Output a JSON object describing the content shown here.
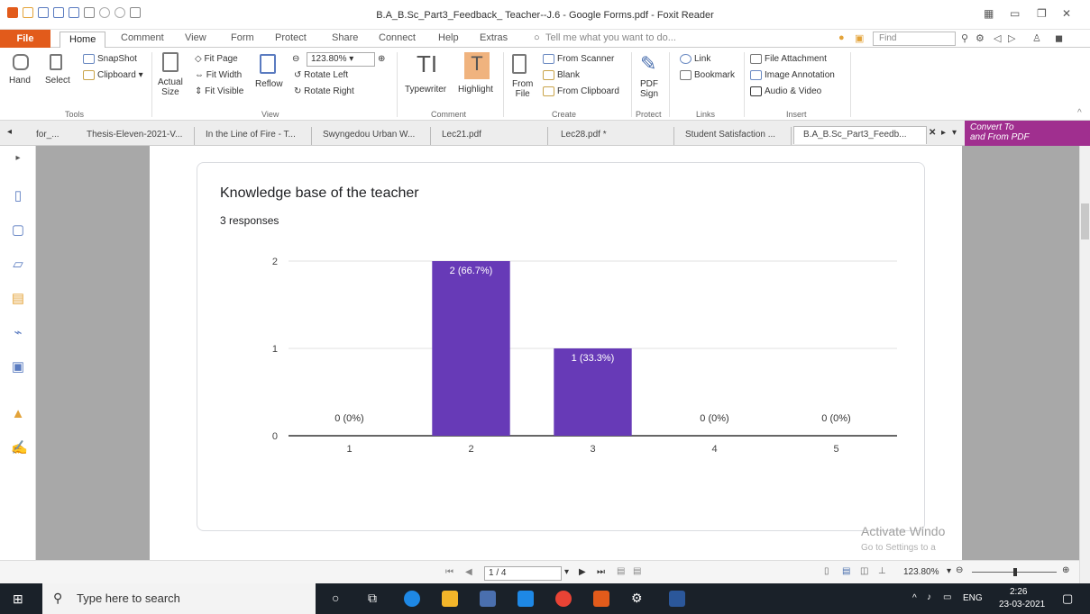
{
  "window": {
    "title": "B.A_B.Sc_Part3_Feedback_ Teacher--J.6 - Google Forms.pdf - Foxit Reader"
  },
  "menu": {
    "tabs": [
      "File",
      "Home",
      "Comment",
      "View",
      "Form",
      "Protect",
      "Share",
      "Connect",
      "Help",
      "Extras"
    ],
    "tell_me": "Tell me what you want to do...",
    "find_placeholder": "Find"
  },
  "ribbon": {
    "tools": {
      "hand": "Hand",
      "select": "Select",
      "snapshot": "SnapShot",
      "clipboard": "Clipboard",
      "group": "Tools"
    },
    "view": {
      "actual_size_1": "Actual",
      "actual_size_2": "Size",
      "fit_page": "Fit Page",
      "fit_width": "Fit Width",
      "fit_visible": "Fit Visible",
      "reflow": "Reflow",
      "zoom": "123.80%",
      "rotate_left": "Rotate Left",
      "rotate_right": "Rotate Right",
      "group": "View"
    },
    "comment": {
      "typewriter": "Typewriter",
      "highlight": "Highlight",
      "group": "Comment"
    },
    "create": {
      "from_file_1": "From",
      "from_file_2": "File",
      "from_scanner": "From Scanner",
      "blank": "Blank",
      "from_clipboard": "From Clipboard",
      "group": "Create"
    },
    "protect": {
      "pdf_sign_1": "PDF",
      "pdf_sign_2": "Sign",
      "group": "Protect"
    },
    "links": {
      "link": "Link",
      "bookmark": "Bookmark",
      "group": "Links"
    },
    "insert": {
      "file_attachment": "File Attachment",
      "image_annotation": "Image Annotation",
      "audio_video": "Audio & Video",
      "group": "Insert"
    }
  },
  "doc_tabs": [
    "for_...",
    "Thesis-Eleven-2021-V...",
    "In the Line of Fire - T...",
    "Swyngedou Urban W...",
    "Lec21.pdf",
    "Lec28.pdf *",
    "Student Satisfaction ...",
    "B.A_B.Sc_Part3_Feedb..."
  ],
  "convert": {
    "line1": "Convert To",
    "line2": "and From PDF"
  },
  "form": {
    "question": "Knowledge base of the teacher",
    "responses": "3 responses"
  },
  "chart_data": {
    "type": "bar",
    "categories": [
      "1",
      "2",
      "3",
      "4",
      "5"
    ],
    "values": [
      0,
      2,
      1,
      0,
      0
    ],
    "data_labels": [
      "0 (0%)",
      "2 (66.7%)",
      "1 (33.3%)",
      "0 (0%)",
      "0 (0%)"
    ],
    "yticks": [
      "0",
      "1",
      "2"
    ],
    "ylim": [
      0,
      2
    ],
    "bar_color": "#673ab7",
    "grid": true
  },
  "watermark": {
    "line1": "Activate Windo",
    "line2": "Go to Settings to a"
  },
  "status": {
    "page": "1 / 4",
    "zoom": "123.80%"
  },
  "taskbar": {
    "search": "Type here to search",
    "lang": "ENG",
    "time": "2:26",
    "date": "23-03-2021"
  }
}
